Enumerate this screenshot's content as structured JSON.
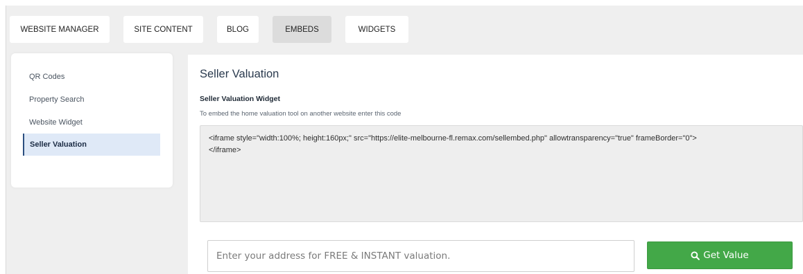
{
  "tabs": [
    {
      "label": "WEBSITE MANAGER",
      "active": false
    },
    {
      "label": "SITE CONTENT",
      "active": false
    },
    {
      "label": "BLOG",
      "active": false
    },
    {
      "label": "EMBEDS",
      "active": true
    },
    {
      "label": "WIDGETS",
      "active": false
    }
  ],
  "sidebar": {
    "items": [
      {
        "label": "QR Codes",
        "active": false
      },
      {
        "label": "Property Search",
        "active": false
      },
      {
        "label": "Website Widget",
        "active": false
      },
      {
        "label": "Seller Valuation",
        "active": true
      }
    ]
  },
  "main": {
    "title": "Seller Valuation",
    "widget_title": "Seller Valuation Widget",
    "description": "To embed the home valuation tool on another website enter this code",
    "embed_code": "<iframe style=\"width:100%; height:160px;\" src=\"https://elite-melbourne-fl.remax.com/sellembed.php\" allowtransparency=\"true\" frameBorder=\"0\">\n</iframe>"
  },
  "preview": {
    "placeholder": "Enter your address for FREE & INSTANT valuation.",
    "button_label": "Get Value",
    "button_icon": "search-icon",
    "button_color": "#43a848"
  }
}
